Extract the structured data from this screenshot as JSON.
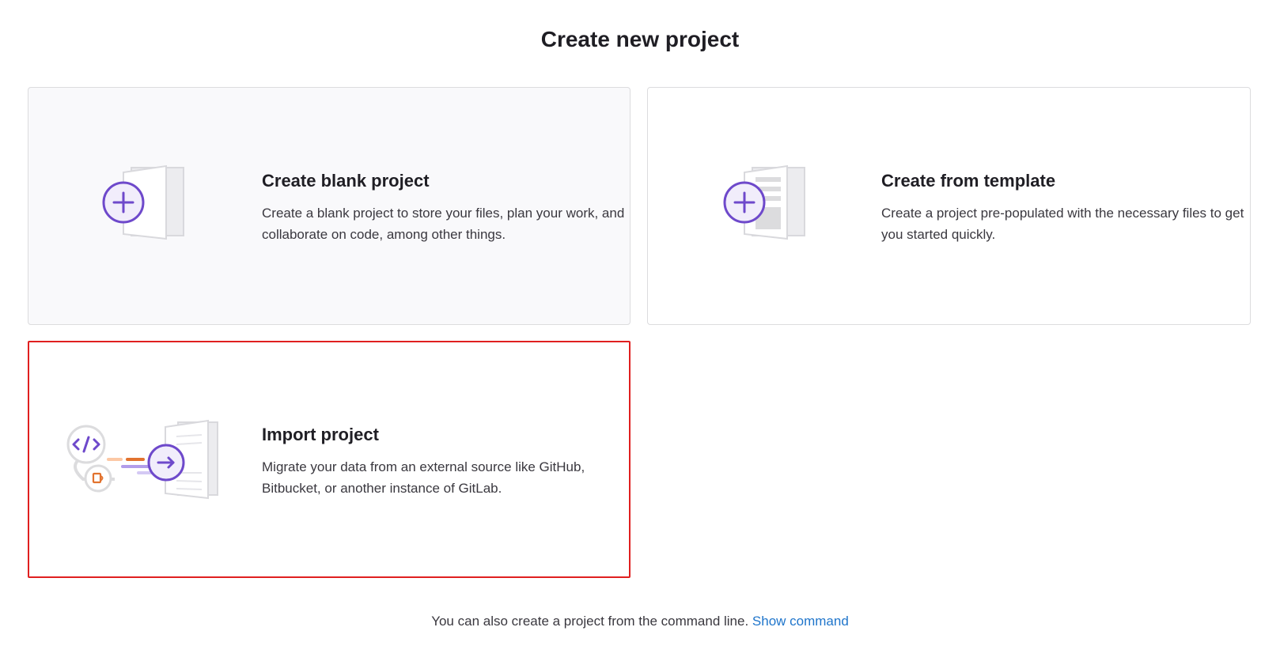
{
  "page_title": "Create new project",
  "cards": {
    "blank": {
      "title": "Create blank project",
      "description": "Create a blank project to store your files, plan your work, and collaborate on code, among other things.",
      "icon": "blank-project-illustration"
    },
    "template": {
      "title": "Create from template",
      "description": "Create a project pre-populated with the necessary files to get you started quickly.",
      "icon": "template-project-illustration"
    },
    "import": {
      "title": "Import project",
      "description": "Migrate your data from an external source like GitHub, Bitbucket, or another instance of GitLab.",
      "icon": "import-project-illustration"
    }
  },
  "footer": {
    "text": "You can also create a project from the command line. ",
    "link_label": "Show command"
  },
  "colors": {
    "accent_purple": "#6e49cb",
    "link_blue": "#1f75cb",
    "highlight_red": "#e02020",
    "orange": "#e2732f"
  }
}
